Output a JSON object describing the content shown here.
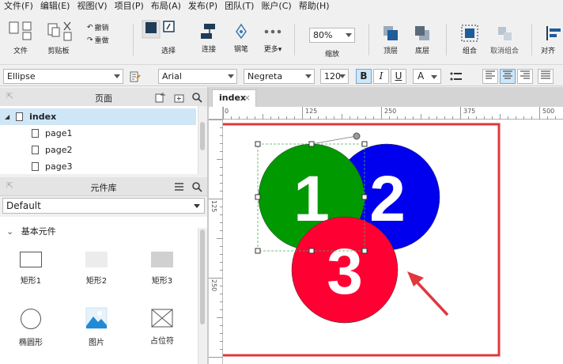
{
  "menu": [
    "文件(F)",
    "编辑(E)",
    "视图(V)",
    "项目(P)",
    "布局(A)",
    "发布(P)",
    "团队(T)",
    "账户(C)",
    "帮助(H)"
  ],
  "toolbar": {
    "file": "文件",
    "clipboard": "剪贴板",
    "undo": "撤销",
    "redo": "重做",
    "select": "选择",
    "connect": "连接",
    "pen": "钢笔",
    "more": "更多▾",
    "zoom_value": "80%",
    "zoom_label": "缩放",
    "top": "顶层",
    "bottom": "底层",
    "group": "组合",
    "ungroup": "取消组合",
    "align": "对齐"
  },
  "format": {
    "shape_name": "Ellipse",
    "font_family": "Arial",
    "font_weight": "Negreta",
    "font_size": "120",
    "bold": "B",
    "italic": "I",
    "underline": "U",
    "font_color": "A"
  },
  "pages_panel": {
    "title": "页面",
    "root": "index",
    "children": [
      "page1",
      "page2",
      "page3"
    ]
  },
  "library_panel": {
    "title": "元件库",
    "library": "Default",
    "section": "基本元件",
    "widgets": [
      "矩形1",
      "矩形2",
      "矩形3",
      "椭圆形",
      "图片",
      "占位符"
    ]
  },
  "canvas": {
    "tab": "index",
    "tab_close": "×",
    "ruler_h": [
      "0",
      "125",
      "250",
      "375",
      "500"
    ],
    "ruler_v": [
      "125",
      "250"
    ],
    "circles": [
      {
        "label": "1",
        "color": "#009900"
      },
      {
        "label": "2",
        "color": "#0000ee"
      },
      {
        "label": "3",
        "color": "#ff0033"
      }
    ],
    "highlight_color": "#e0383e"
  }
}
